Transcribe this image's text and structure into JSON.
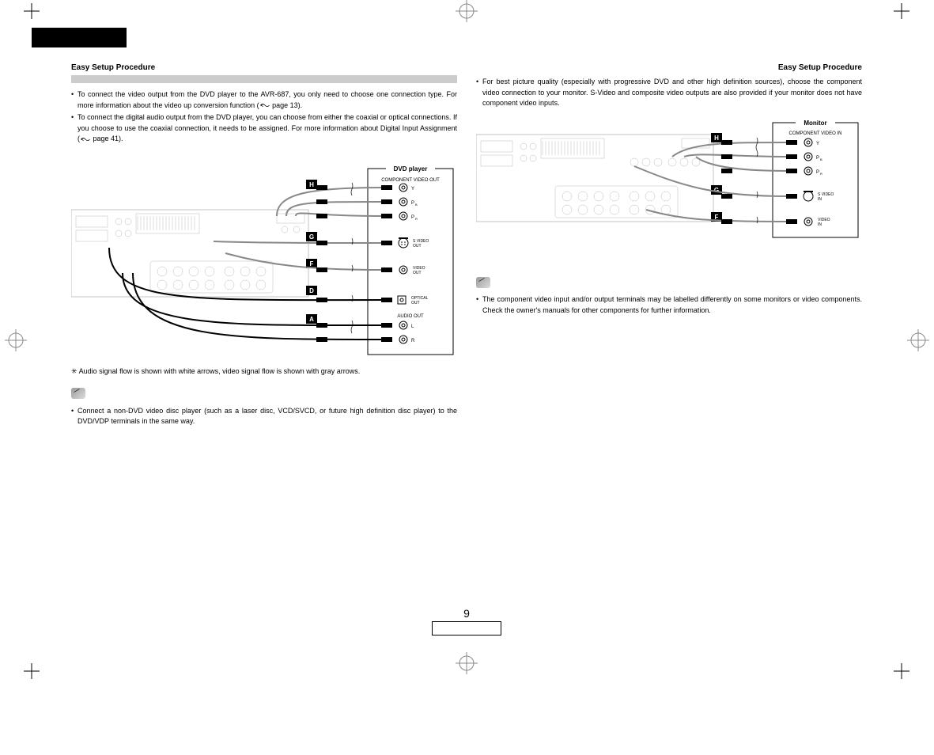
{
  "header": {
    "left": "Easy Setup Procedure",
    "right": "Easy Setup Procedure"
  },
  "left_col": {
    "b1": "To connect the video output from the DVD player to the AVR-687, you only need to choose one connection type. For more information about the video up conversion function (",
    "b1b": " page 13).",
    "b2": "To connect the digital audio output from the DVD player, you can choose from either the coaxial or optical connections. If you choose to use the coaxial connection, it needs to be assigned. For more information about Digital Input Assignment (",
    "b2b": " page 41).",
    "signal_note": "Audio signal flow is shown with white arrows, video signal flow is shown with gray arrows.",
    "note1": "Connect a non-DVD video disc player (such as a laser disc, VCD/SVCD, or future high definition disc player) to the DVD/VDP terminals in the same way."
  },
  "right_col": {
    "b1": "For best picture quality (especially with progressive DVD and other high definition sources), choose the component video connection to your monitor. S-Video and composite video outputs are also provided if your monitor does not have component video inputs.",
    "note1": "The component video input and/or output terminals may be labelled differently on some monitors or video components. Check the owner's manuals for other components for further information."
  },
  "diagram1": {
    "title": "DVD player",
    "comp_out": "COMPONENT VIDEO OUT",
    "y": "Y",
    "pb": "PB",
    "pr": "PR",
    "svideo": "S VIDEO OUT",
    "video": "VIDEO OUT",
    "optical": "OPTICAL OUT",
    "audio_out": "AUDIO OUT",
    "l": "L",
    "r": "R",
    "labels": {
      "h": "H",
      "g": "G",
      "f": "F",
      "d": "D",
      "a": "A"
    }
  },
  "diagram2": {
    "title": "Monitor",
    "comp_in": "COMPONENT VIDEO IN",
    "y": "Y",
    "pb": "PB",
    "pr": "PR",
    "svideo": "S VIDEO IN",
    "video": "VIDEO IN",
    "labels": {
      "h": "H",
      "g": "G",
      "f": "F"
    }
  },
  "pagenum": "9",
  "star": "✳"
}
